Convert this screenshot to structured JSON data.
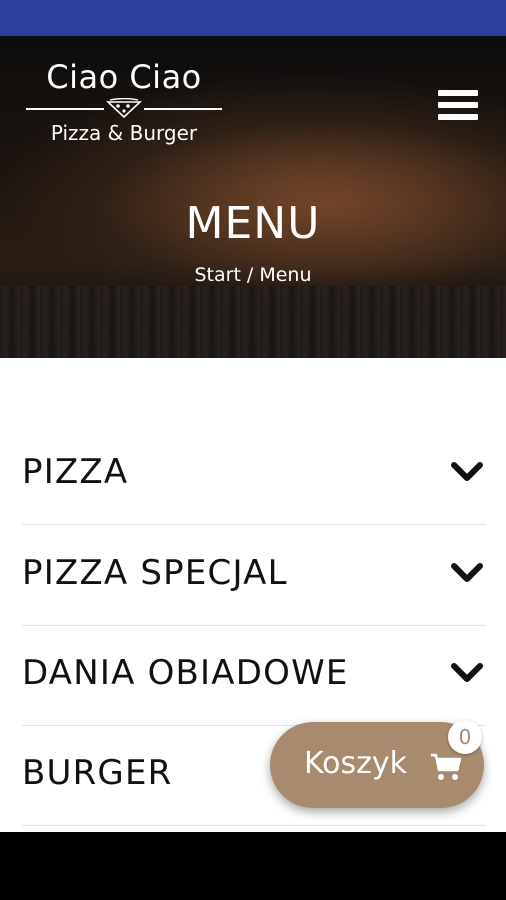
{
  "header": {
    "logo_title": "Ciao Ciao",
    "logo_subtitle": "Pizza & Burger"
  },
  "hero": {
    "title": "MENU",
    "breadcrumb": {
      "home": "Start",
      "separator": "/",
      "current": "Menu"
    }
  },
  "categories": [
    {
      "label": "PIZZA",
      "icon": "chevron-down-icon"
    },
    {
      "label": "PIZZA SPECJAL",
      "icon": "chevron-down-icon"
    },
    {
      "label": "DANIA OBIADOWE",
      "icon": "chevron-down-icon"
    },
    {
      "label": "BURGER",
      "icon": "chevron-down-icon"
    }
  ],
  "cart": {
    "label": "Koszyk",
    "count": "0",
    "icon": "cart-icon"
  },
  "colors": {
    "status_bar": "#2c3e9e",
    "cart_button": "#a88a6e",
    "text": "#111111"
  }
}
